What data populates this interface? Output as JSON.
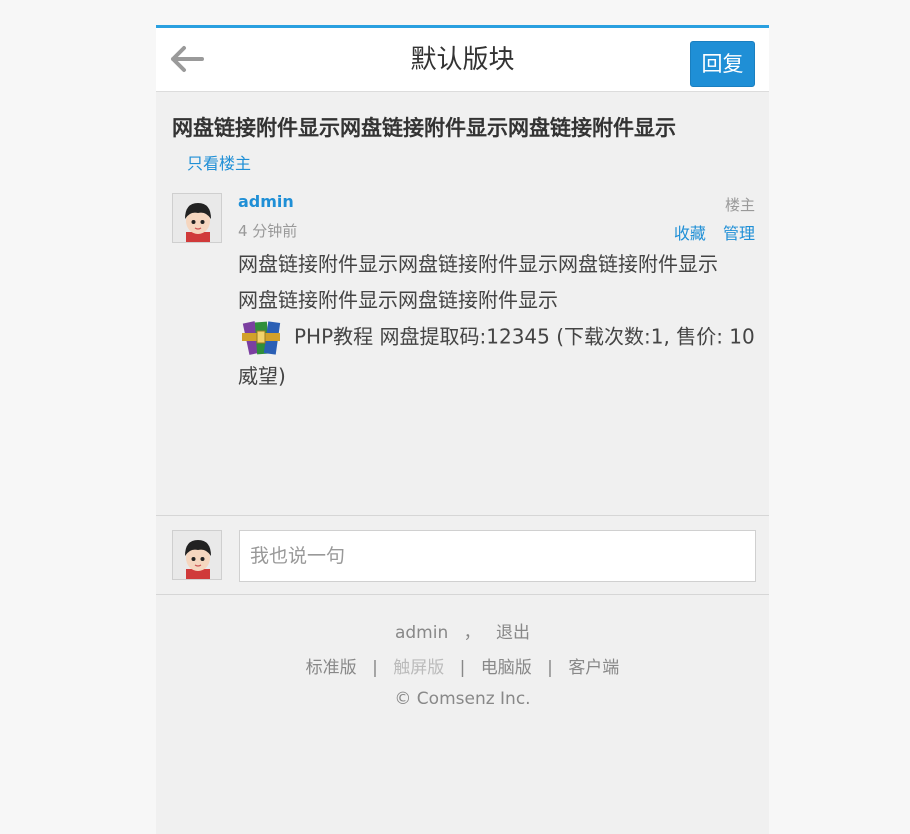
{
  "header": {
    "title": "默认版块",
    "reply_label": "回复"
  },
  "thread": {
    "title": "网盘链接附件显示网盘链接附件显示网盘链接附件显示",
    "only_author_label": "只看楼主"
  },
  "post": {
    "author": "admin",
    "time": "4 分钟前",
    "floor": "楼主",
    "favorite_label": "收藏",
    "manage_label": "管理",
    "line1": "网盘链接附件显示网盘链接附件显示网盘链接附件显示",
    "line2": "网盘链接附件显示网盘链接附件显示",
    "attachment": "PHP教程 网盘提取码:12345 (下载次数:1, 售价: 10威望)"
  },
  "comment": {
    "placeholder": "我也说一句"
  },
  "footer": {
    "user": "admin",
    "comma": "，",
    "logout": "退出",
    "links": [
      "标准版",
      "触屏版",
      "电脑版",
      "客户端"
    ],
    "copyright": "© Comsenz Inc."
  },
  "colors": {
    "accent": "#1f8fd6",
    "top_border": "#2aa0e0"
  }
}
